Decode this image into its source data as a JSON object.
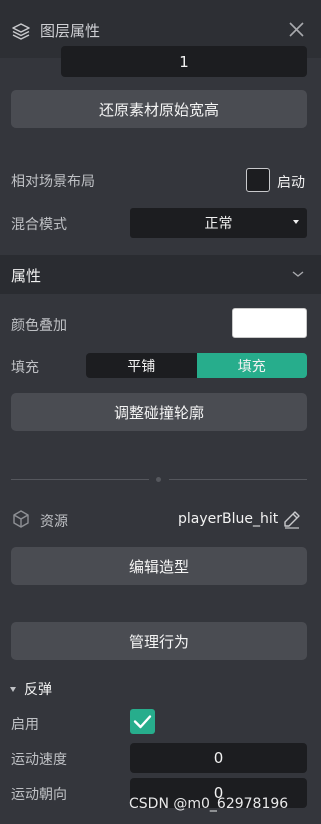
{
  "header": {
    "title": "图层属性"
  },
  "top_number": "1",
  "buttons": {
    "restore_size": "还原素材原始宽高",
    "adjust_collision": "调整碰撞轮廓",
    "edit_shape": "编辑造型",
    "manage_behavior": "管理行为"
  },
  "relative_layout": {
    "label": "相对场景布局",
    "checkbox_label": "启动",
    "checked": false
  },
  "blend_mode": {
    "label": "混合模式",
    "value": "正常"
  },
  "properties_section": {
    "title": "属性"
  },
  "color_overlay": {
    "label": "颜色叠加",
    "color": "#ffffff"
  },
  "fill": {
    "label": "填充",
    "options": [
      "平铺",
      "填充"
    ],
    "selected": "填充"
  },
  "resource": {
    "label": "资源",
    "value": "playerBlue_hit"
  },
  "behavior": {
    "title": "反弹",
    "enable_label": "启用",
    "enabled": true,
    "speed_label": "运动速度",
    "speed_value": "0",
    "direction_label": "运动朝向",
    "direction_value": "0"
  },
  "watermark": "CSDN @m0_62978196",
  "colors": {
    "accent": "#27ad8c",
    "panel_bg": "#34363c",
    "field_bg": "#1c1d20",
    "button_bg": "#4a4c52"
  },
  "icons": [
    "layers-icon",
    "close-icon",
    "chevron-down-icon",
    "cube-icon",
    "edit-icon",
    "checkmark-icon",
    "triangle-down-icon"
  ]
}
